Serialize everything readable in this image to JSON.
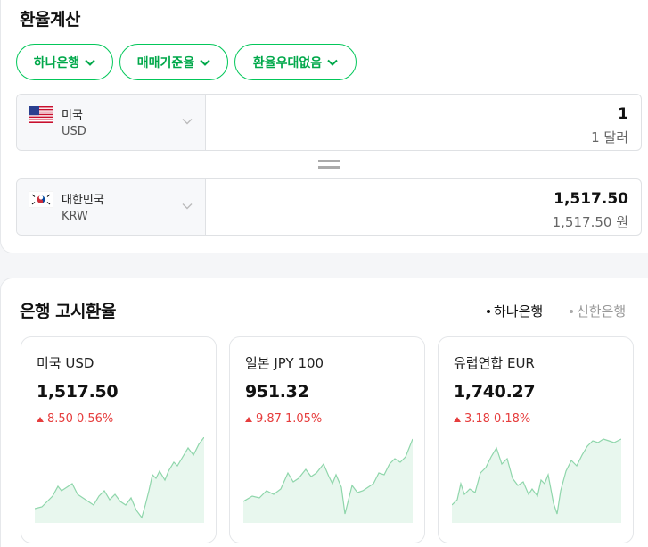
{
  "calculator": {
    "title": "환율계산",
    "filters": [
      {
        "label": "하나은행"
      },
      {
        "label": "매매기준율"
      },
      {
        "label": "환율우대없음"
      }
    ],
    "from": {
      "name": "미국",
      "code": "USD",
      "amount": "1",
      "amount_words": "1 달러",
      "flag_icon": "us-flag-icon"
    },
    "to": {
      "name": "대한민국",
      "code": "KRW",
      "amount": "1,517.50",
      "amount_words": "1,517.50 원",
      "flag_icon": "kr-flag-icon"
    }
  },
  "bank_rates": {
    "title": "은행 고시환율",
    "banks": [
      {
        "label": "하나은행",
        "active": true
      },
      {
        "label": "신한은행",
        "active": false
      }
    ],
    "cards": [
      {
        "name": "미국 USD",
        "rate": "1,517.50",
        "change": "8.50",
        "percent": "0.56%",
        "direction": "up"
      },
      {
        "name": "일본 JPY 100",
        "rate": "951.32",
        "change": "9.87",
        "percent": "1.05%",
        "direction": "up"
      },
      {
        "name": "유럽연합 EUR",
        "rate": "1,740.27",
        "change": "3.18",
        "percent": "0.18%",
        "direction": "up"
      }
    ]
  },
  "colors": {
    "accent": "#03c75a",
    "up": "#e63d3d",
    "spark_line": "#8fd6ab",
    "spark_fill": "#e8f7ee"
  }
}
